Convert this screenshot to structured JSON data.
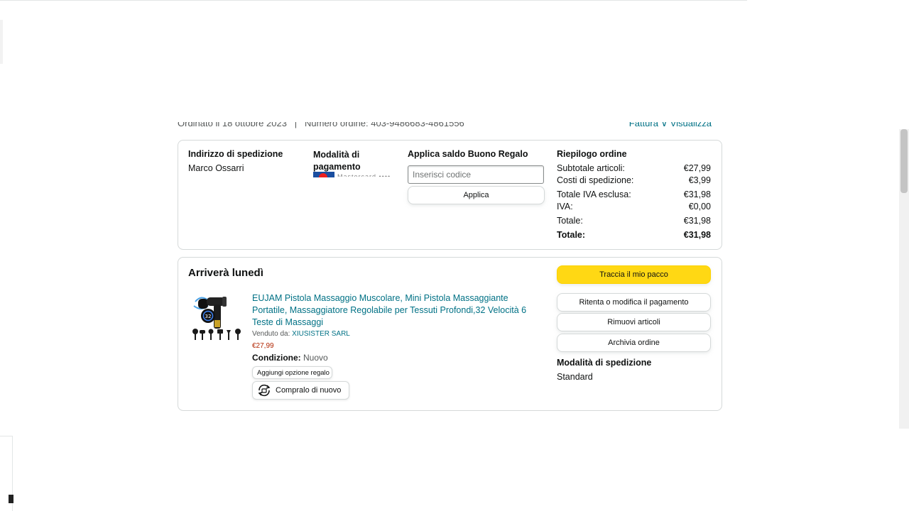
{
  "order_meta": {
    "placed_on": "Ordinato il 18 ottobre 2023",
    "order_number": "Numero ordine: 403-9486683-4861556",
    "right_links": "Fattura  ∨  Visualizza"
  },
  "summary_card": {
    "shipping_address": {
      "heading": "Indirizzo di spedizione",
      "name": "Marco Ossarri"
    },
    "payment": {
      "heading_line1": "Modalità di",
      "heading_line2": "pagamento",
      "card_text": "Mastercard ••••"
    },
    "gift_card": {
      "heading": "Applica saldo Buono Regalo",
      "placeholder": "Inserisci codice",
      "apply_label": "Applica"
    },
    "order_summary": {
      "heading": "Riepilogo ordine",
      "rows": [
        {
          "label": "Subtotale articoli:",
          "value": "€27,99"
        },
        {
          "label": "Costi di spedizione:",
          "value": "€3,99"
        },
        {
          "label": "Totale IVA esclusa:",
          "value": "€31,98"
        },
        {
          "label": "IVA:",
          "value": "€0,00"
        },
        {
          "label": "Totale:",
          "value": "€31,98"
        },
        {
          "label": "Totale:",
          "value": "€31,98"
        }
      ]
    }
  },
  "delivery_card": {
    "title": "Arriverà lunedì",
    "product": {
      "title": "EUJAM Pistola Massaggio Muscolare, Mini Pistola Massaggiante Portatile, Massaggiatore Regolabile per Tessuti Profondi,32 Velocità 6 Teste di Massaggi",
      "sold_by_label": "Venduto da:",
      "seller": "XIUSISTER SARL",
      "price": "€27,99",
      "condition_label": "Condizione:",
      "condition": "Nuovo",
      "gift_option_label": "Aggiungi opzione regalo",
      "buy_again_label": "Compralo di nuovo",
      "display_number": "32"
    },
    "actions": {
      "track": "Traccia il mio pacco",
      "retry_payment": "Ritenta o modifica il pagamento",
      "remove_items": "Rimuovi articoli",
      "archive": "Archivia ordine"
    },
    "shipping_method": {
      "heading": "Modalità di spedizione",
      "value": "Standard"
    }
  },
  "colors": {
    "link": "#007185",
    "price": "#b12704",
    "primary_button": "#ffd814",
    "border": "#d5d9d9"
  }
}
